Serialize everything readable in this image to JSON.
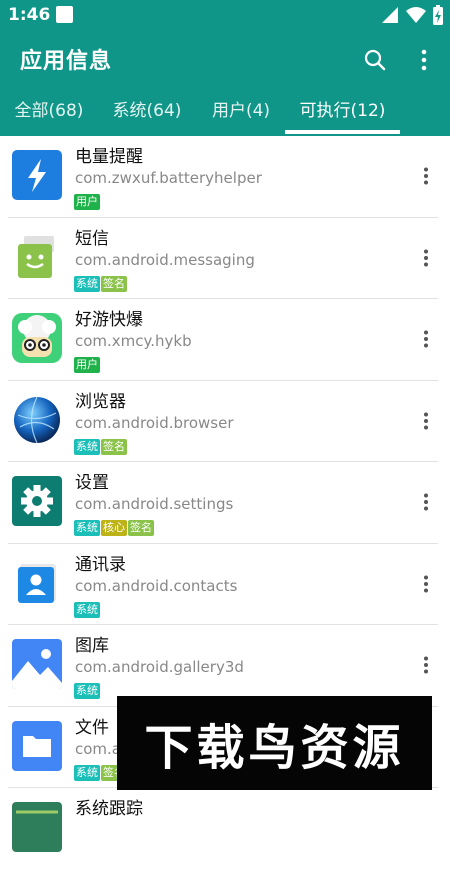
{
  "status_bar": {
    "time": "1:46"
  },
  "app_bar": {
    "title": "应用信息"
  },
  "tabs": [
    {
      "label": "全部(68)"
    },
    {
      "label": "系统(64)"
    },
    {
      "label": "用户(4)"
    },
    {
      "label": "可执行(12)"
    }
  ],
  "apps": [
    {
      "name": "电量提醒",
      "package": "com.zwxuf.batteryhelper",
      "tags": [
        "用户"
      ]
    },
    {
      "name": "短信",
      "package": "com.android.messaging",
      "tags": [
        "系统",
        "签名"
      ]
    },
    {
      "name": "好游快爆",
      "package": "com.xmcy.hykb",
      "tags": [
        "用户"
      ]
    },
    {
      "name": "浏览器",
      "package": "com.android.browser",
      "tags": [
        "系统",
        "签名"
      ]
    },
    {
      "name": "设置",
      "package": "com.android.settings",
      "tags": [
        "系统",
        "核心",
        "签名"
      ]
    },
    {
      "name": "通讯录",
      "package": "com.android.contacts",
      "tags": [
        "系统"
      ]
    },
    {
      "name": "图库",
      "package": "com.android.gallery3d",
      "tags": [
        "系统"
      ]
    },
    {
      "name": "文件",
      "package": "com.a",
      "tags": [
        "系统",
        "签名"
      ]
    },
    {
      "name": "系统跟踪",
      "package": "",
      "tags": []
    }
  ],
  "watermark": {
    "text": "下载鸟资源"
  },
  "colors": {
    "primary": "#0f9688",
    "tag_user": "#1fb14a",
    "tag_system": "#1cbfb8",
    "tag_sign": "#8bc34a",
    "tag_core": "#bdb316"
  }
}
